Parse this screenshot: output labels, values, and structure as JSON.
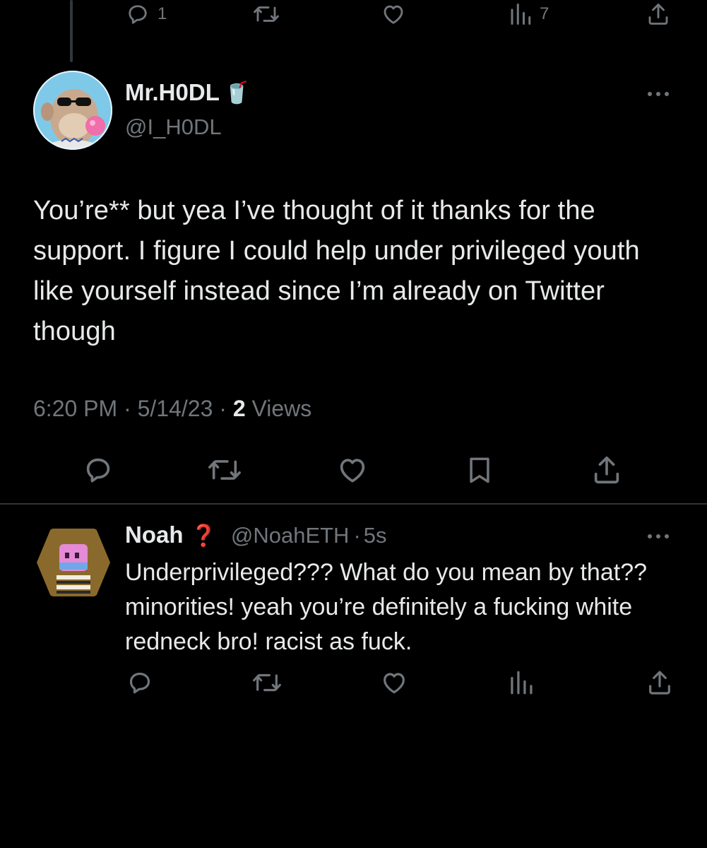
{
  "previous_tweet": {
    "actions": {
      "reply_count": "1",
      "retweet_count": "",
      "like_count": "",
      "views_count": "7"
    },
    "action_icons": [
      "reply-icon",
      "retweet-icon",
      "like-icon",
      "views-icon",
      "share-icon"
    ]
  },
  "main_tweet": {
    "display_name": "Mr.H0DL",
    "name_emoji": "🥤",
    "handle": "@I_H0DL",
    "more_icon": "more-icon",
    "text": "You’re** but yea I’ve thought of it thanks for the support. I figure I could help under privileged youth like yourself instead since I’m already on Twitter though",
    "time": "6:20 PM",
    "separator": "·",
    "date": "5/14/23",
    "views_count": "2",
    "views_label": "Views",
    "action_icons": [
      "reply-icon",
      "retweet-icon",
      "like-icon",
      "bookmark-icon",
      "share-icon"
    ]
  },
  "reply_tweet": {
    "display_name": "Noah",
    "name_emoji": "❓",
    "handle": "@NoahETH",
    "separator": "·",
    "time_ago": "5s",
    "more_icon": "more-icon",
    "text": "Underprivileged???  What do you mean by that?? minorities! yeah you’re definitely a fucking white redneck bro! racist as fuck.",
    "action_icons": [
      "reply-icon",
      "retweet-icon",
      "like-icon",
      "views-icon",
      "share-icon"
    ]
  },
  "colors": {
    "background": "#000000",
    "text_primary": "#e7e9ea",
    "text_secondary": "#71767b",
    "divider": "#2f3336",
    "thread_line": "#333639"
  }
}
